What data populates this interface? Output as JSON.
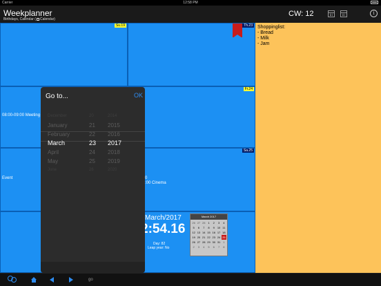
{
  "statusbar": {
    "carrier": "Carrier",
    "time": "12:58 PM"
  },
  "header": {
    "title": "Weekplanner",
    "subtitle": "Birthdays, Calendar (",
    "subtitle_end": "Calendar)",
    "cw": "CW: 12",
    "info": "i"
  },
  "days": {
    "su": "Su.19",
    "th": "Th.23",
    "fr": "Fr.24",
    "sa": "Sa.25"
  },
  "events": {
    "meeting": "08:00-09:00  Meeting",
    "event": "Event",
    "cinema_0": "0",
    "cinema": ":00  Cinema"
  },
  "notes": {
    "title": "Shoppinglist:",
    "items": [
      "- Bread",
      "- Milk",
      "- Jam"
    ]
  },
  "clock": {
    "date": "March/2017",
    "time": "2:54.16",
    "day": "Day: 82",
    "leap": "Leap year: No"
  },
  "minical": {
    "title": "March 2017",
    "days": [
      "26",
      "27",
      "28",
      "1",
      "2",
      "3",
      "4",
      "5",
      "6",
      "7",
      "8",
      "9",
      "10",
      "11",
      "12",
      "13",
      "14",
      "15",
      "16",
      "17",
      "18",
      "19",
      "20",
      "21",
      "22",
      "23",
      "24",
      "25",
      "26",
      "27",
      "28",
      "29",
      "30",
      "31",
      "1",
      "2",
      "3",
      "4",
      "5",
      "6",
      "7",
      "8"
    ],
    "today_index": 27
  },
  "goto": {
    "title": "Go to...",
    "ok": "OK",
    "months": [
      "December",
      "January",
      "February",
      "March",
      "April",
      "May",
      "June"
    ],
    "days": [
      "20",
      "21",
      "22",
      "23",
      "24",
      "25",
      "26"
    ],
    "years": [
      "2014",
      "2015",
      "2016",
      "2017",
      "2018",
      "2019",
      "2020"
    ],
    "selected_index": 3
  },
  "toolbar": {
    "go": "go"
  },
  "colors": {
    "accent": "#2e8cf0",
    "cell": "#1c90f3",
    "notes": "#fdc35a",
    "today": "#c71c1c",
    "tag_yellow": "#ffff33",
    "tag_navy": "#001a66"
  }
}
